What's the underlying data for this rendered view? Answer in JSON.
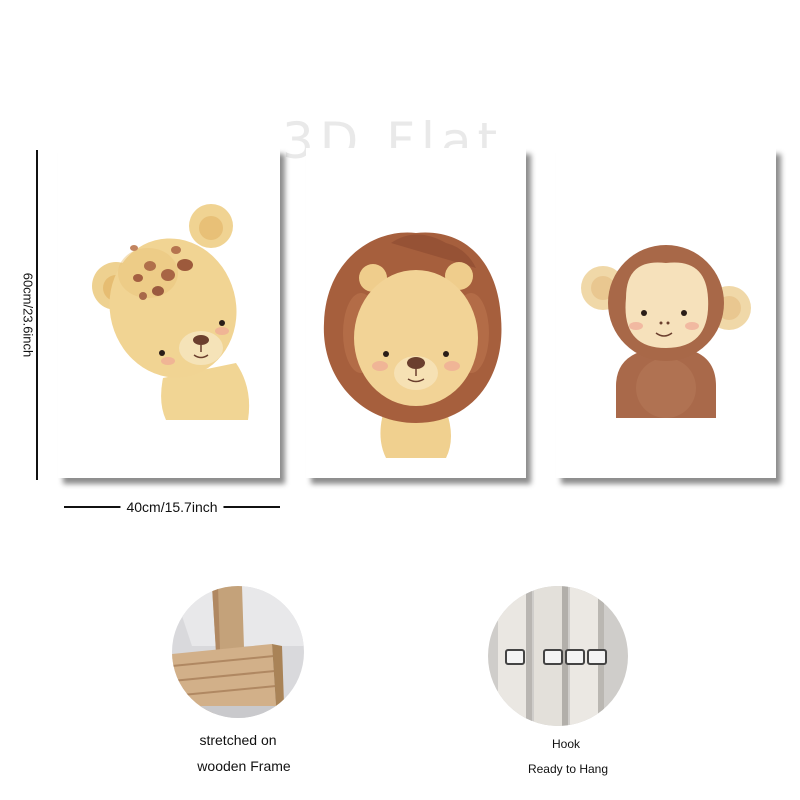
{
  "watermark": "3D Flat",
  "dimensions": {
    "height": "60cm/23.6inch",
    "width": "40cm/15.7inch"
  },
  "paintings": [
    {
      "subject": "leopard"
    },
    {
      "subject": "lion"
    },
    {
      "subject": "monkey"
    }
  ],
  "details": [
    {
      "lines": [
        "stretched on",
        "wooden Frame"
      ]
    },
    {
      "lines": [
        "Hook",
        "Ready to Hang"
      ]
    }
  ]
}
